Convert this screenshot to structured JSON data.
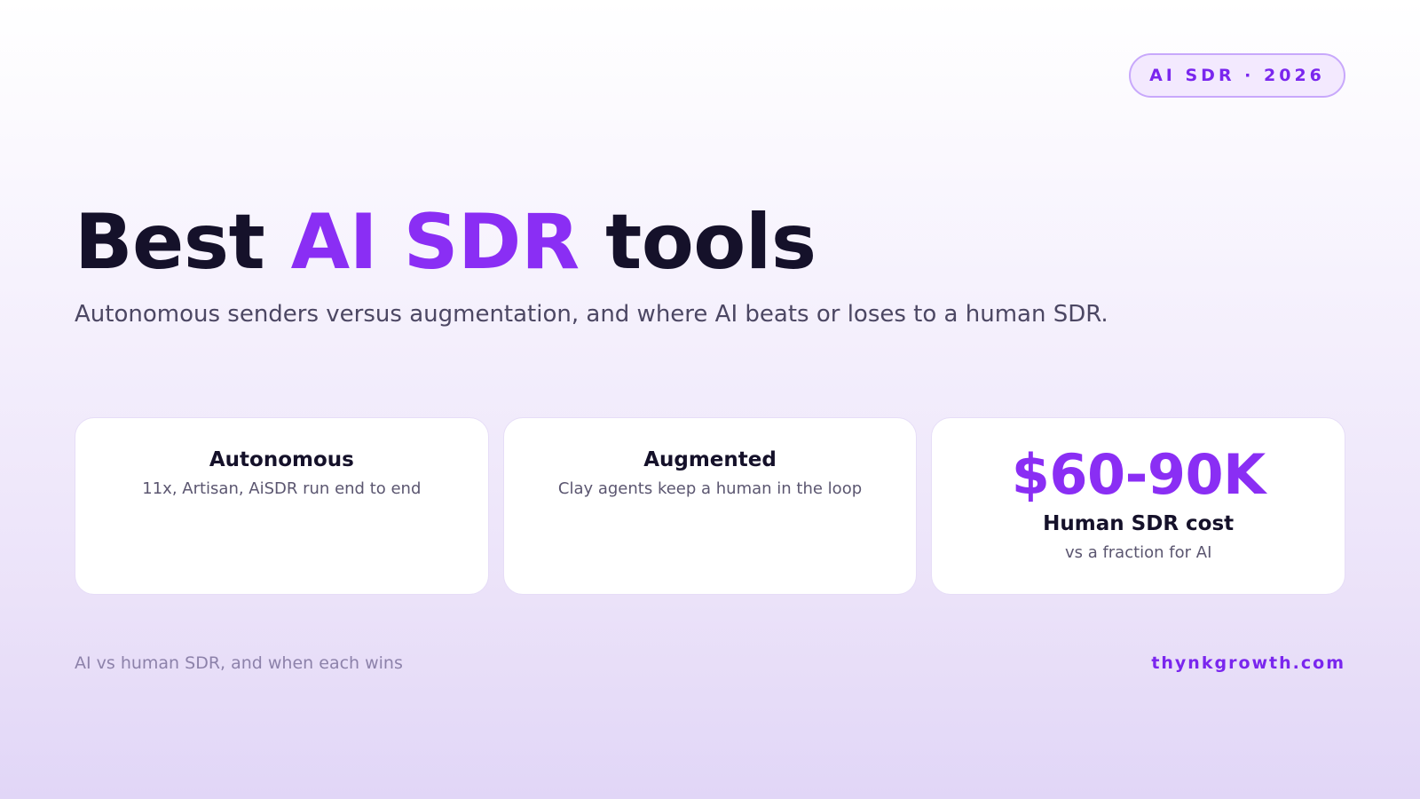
{
  "badge": {
    "label": "AI SDR · 2026"
  },
  "hero": {
    "title_before": "Best ",
    "title_accent": "AI SDR",
    "title_after": " tools",
    "subtitle": "Autonomous senders versus augmentation, and where AI beats or loses to a human SDR."
  },
  "cards": [
    {
      "title": "Autonomous",
      "description": "11x, Artisan, AiSDR run end to end"
    },
    {
      "title": "Augmented",
      "description": "Clay agents keep a human in the loop"
    },
    {
      "value": "$60-90K",
      "title": "Human SDR cost",
      "description": "vs a fraction for AI"
    }
  ],
  "footer": {
    "caption": "AI vs human SDR, and when each wins",
    "site": "thynkgrowth.com"
  },
  "colors": {
    "accent": "#8a2ef4",
    "heading": "#15112a",
    "badge_border": "#c8a8fb",
    "badge_background": "#f3e9fe"
  }
}
